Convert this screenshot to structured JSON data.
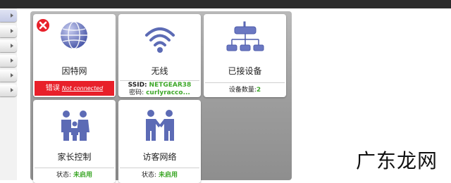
{
  "tiles": {
    "internet": {
      "label": "因特网",
      "status_label": "错误",
      "status_detail": "Not connected"
    },
    "wireless": {
      "label": "无线",
      "ssid_label": "SSID:",
      "ssid_value": "NETGEAR38",
      "password_label": "密码:",
      "password_value": "curlyracco..."
    },
    "attached_devices": {
      "label": "已接设备",
      "count_label": "设备数量:",
      "count_value": "2"
    },
    "parental_controls": {
      "label": "家长控制",
      "status_label": "状态:",
      "status_value": "未启用"
    },
    "guest_network": {
      "label": "访客网络",
      "status_label": "状态:",
      "status_value": "未启用"
    }
  },
  "colors": {
    "error": "#e8202a",
    "ok_green": "#3ea82a",
    "icon_blue": "#5c6bb5"
  },
  "watermark": "广东龙网"
}
